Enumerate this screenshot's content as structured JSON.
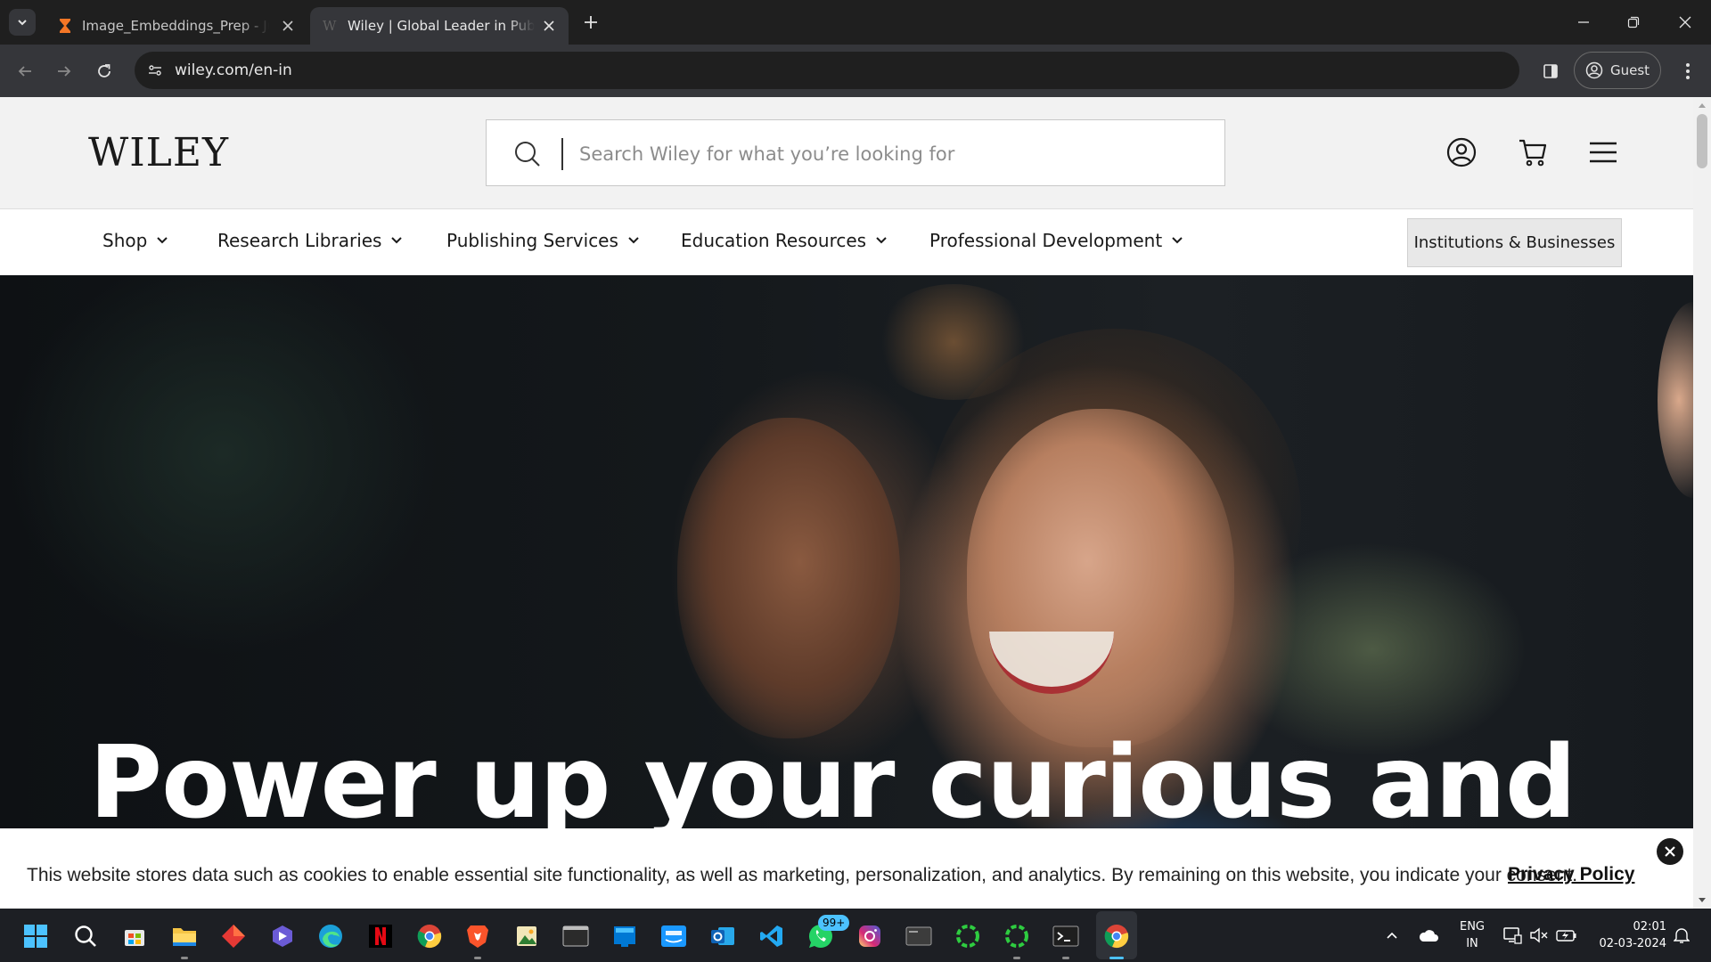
{
  "browser": {
    "tabs": [
      {
        "title": "Image_Embeddings_Prep - Jupyter",
        "favicon": "jupyter-hourglass-icon",
        "active": false
      },
      {
        "title": "Wiley | Global Leader in Publishing",
        "favicon": "wiley-w-icon",
        "active": true
      }
    ],
    "url": "wiley.com/en-in",
    "profile_label": "Guest",
    "accent_color": "#35363a"
  },
  "site": {
    "logo_text": "WILEY",
    "search_placeholder": "Search Wiley for what you’re looking for",
    "nav": [
      {
        "label": "Shop"
      },
      {
        "label": "Research Libraries"
      },
      {
        "label": "Publishing Services"
      },
      {
        "label": "Education Resources"
      },
      {
        "label": "Professional Development"
      }
    ],
    "institutions_button": "Institutions & Businesses",
    "hero_title": "Power up your curious and",
    "cookie": {
      "text": "This website stores data such as cookies to enable essential site functionality, as well as marketing, personalization, and analytics. By remaining on this website, you indicate your consent.",
      "link_label": "Privacy Policy"
    }
  },
  "taskbar": {
    "apps": [
      "start-icon",
      "search-icon",
      "store-icon",
      "file-explorer-icon",
      "app-red-diamond-icon",
      "app-purple-icon",
      "edge-icon",
      "netflix-icon",
      "chrome-icon",
      "brave-icon",
      "image-viewer-icon",
      "terminal-icon",
      "windows-sandbox-icon",
      "prime-video-icon",
      "outlook-icon",
      "vscode-icon",
      "whatsapp-icon",
      "instagram-icon",
      "app-window-icon",
      "green-ring-icon",
      "green-ring-icon-2",
      "command-prompt-icon",
      "chrome-icon-active"
    ],
    "whatsapp_badge": "99+",
    "language_line1": "ENG",
    "language_line2": "IN",
    "time": "02:01",
    "date": "02-03-2024"
  }
}
